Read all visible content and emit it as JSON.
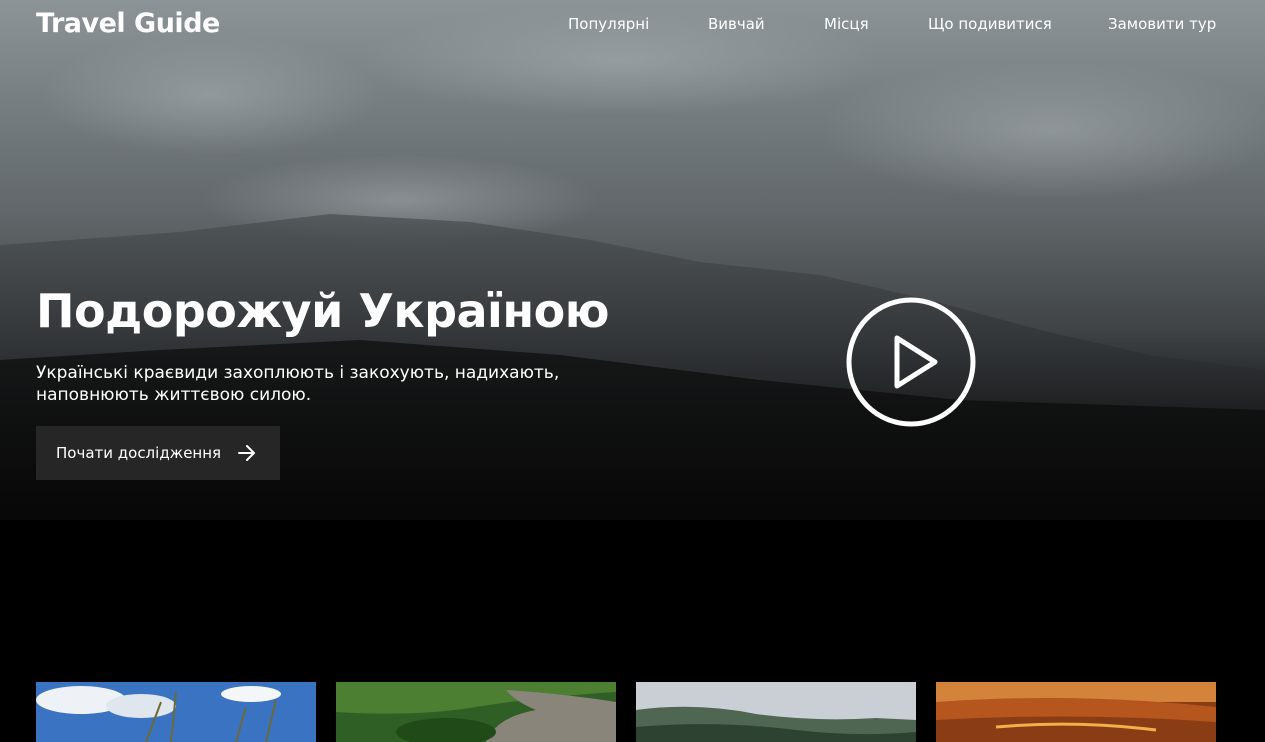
{
  "header": {
    "logo": "Travel Guide",
    "nav": [
      {
        "label": "Популярні"
      },
      {
        "label": "Вивчай"
      },
      {
        "label": "Місця"
      },
      {
        "label": "Що подивитися"
      },
      {
        "label": "Замовити тур"
      }
    ]
  },
  "hero": {
    "title": "Подорожуй Україною",
    "subtitle": "Українські краєвиди захоплюють і закохують, надихають, наповнюють життєвою силою.",
    "cta_label": "Почати дослідження",
    "cta_icon": "arrow-right-icon",
    "play_icon": "play-icon"
  },
  "cards": [
    {
      "name": "card-sky-meadow"
    },
    {
      "name": "card-forest-river"
    },
    {
      "name": "card-mountains"
    },
    {
      "name": "card-sunset-lake"
    }
  ],
  "colors": {
    "background": "#000000",
    "button": "#262626",
    "text": "#ffffff"
  }
}
